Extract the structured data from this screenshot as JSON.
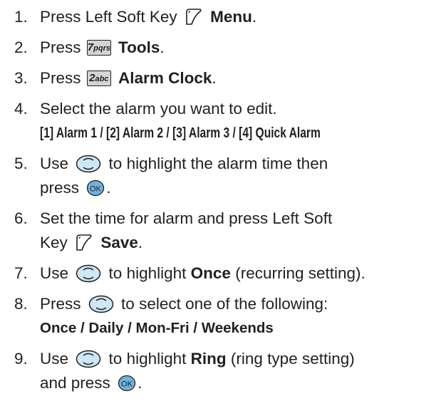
{
  "steps": [
    {
      "num": "1.",
      "pre": "Press Left Soft Key",
      "bold": "Menu",
      "post": "."
    },
    {
      "num": "2.",
      "pre": "Press",
      "key": "7pqrs",
      "bold": "Tools",
      "post": "."
    },
    {
      "num": "3.",
      "pre": "Press",
      "key": "2abc",
      "bold": "Alarm Clock",
      "post": "."
    },
    {
      "num": "4.",
      "text": "Select the alarm you want to edit.",
      "sub": "[1] Alarm 1 / [2] Alarm 2 / [3] Alarm 3 / [4] Quick Alarm"
    },
    {
      "num": "5.",
      "pre": "Use",
      "post": "to highlight the alarm time then",
      "line2_pre": "press",
      "line2_post": "."
    },
    {
      "num": "6.",
      "text": "Set the time for alarm and press Left Soft",
      "line2_pre": "Key",
      "bold": "Save",
      "line2_post": "."
    },
    {
      "num": "7.",
      "pre": "Use",
      "mid": "to highlight",
      "bold": "Once",
      "post": "(recurring setting)."
    },
    {
      "num": "8.",
      "pre": "Press",
      "post": "to select one of the following:",
      "sub_parts": [
        "Once",
        "/",
        "Daily",
        "/",
        "Mon-Fri",
        "/",
        "Weekends"
      ]
    },
    {
      "num": "9.",
      "pre": "Use",
      "mid": "to highlight",
      "bold": "Ring",
      "post": "(ring type setting)",
      "line2_pre": "and press",
      "line2_post": "."
    }
  ],
  "icons": {
    "soft_key": "left-soft-key-icon",
    "nav_key": "navigation-key-icon",
    "ok_key": "ok-key-icon",
    "ok_label": "OK"
  },
  "keys": {
    "k7_digit": "7",
    "k7_letters": "pqrs",
    "k2_digit": "2",
    "k2_letters": "abc"
  },
  "colors": {
    "text": "#231f20",
    "nav_fill": "#cfe6f5",
    "nav_stroke": "#231f20",
    "ok_fill": "#6fb3e0"
  }
}
